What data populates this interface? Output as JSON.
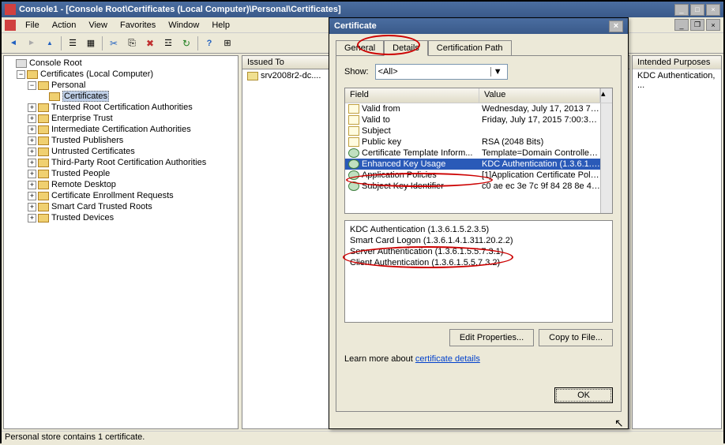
{
  "window": {
    "title": "Console1 - [Console Root\\Certificates (Local Computer)\\Personal\\Certificates]"
  },
  "menu": {
    "file": "File",
    "action": "Action",
    "view": "View",
    "favorites": "Favorites",
    "window": "Window",
    "help": "Help"
  },
  "tree": {
    "root": "Console Root",
    "certs": "Certificates (Local Computer)",
    "personal": "Personal",
    "certificates": "Certificates",
    "trca": "Trusted Root Certification Authorities",
    "et": "Enterprise Trust",
    "ica": "Intermediate Certification Authorities",
    "tpub": "Trusted Publishers",
    "uc": "Untrusted Certificates",
    "tprca": "Third-Party Root Certification Authorities",
    "tp": "Trusted People",
    "rd": "Remote Desktop",
    "cer": "Certificate Enrollment Requests",
    "sctr": "Smart Card Trusted Roots",
    "td": "Trusted Devices"
  },
  "list": {
    "col_issued": "Issued To",
    "col_intended": "Intended Purposes",
    "row0_issued": "srv2008r2-dc....",
    "row0_intended": "KDC Authentication, ..."
  },
  "dialog": {
    "title": "Certificate",
    "tab_general": "General",
    "tab_details": "Details",
    "tab_certpath": "Certification Path",
    "show_label": "Show:",
    "show_value": "<All>",
    "col_field": "Field",
    "col_value": "Value",
    "fields": [
      {
        "icon": "page",
        "name": "Valid from",
        "value": "Wednesday, July 17, 2013 7:..."
      },
      {
        "icon": "page",
        "name": "Valid to",
        "value": "Friday, July 17, 2015 7:00:39 ..."
      },
      {
        "icon": "page",
        "name": "Subject",
        "value": ""
      },
      {
        "icon": "page",
        "name": "Public key",
        "value": "RSA (2048 Bits)"
      },
      {
        "icon": "ext",
        "name": "Certificate Template Inform...",
        "value": "Template=Domain Controller L..."
      },
      {
        "icon": "ext",
        "name": "Enhanced Key Usage",
        "value": "KDC Authentication (1.3.6.1.5...",
        "selected": true
      },
      {
        "icon": "ext",
        "name": "Application Policies",
        "value": "[1]Application Certificate Polic..."
      },
      {
        "icon": "ext",
        "name": "Subject Key Identifier",
        "value": "c0 ae ec 3e 7c 9f 84 28 8e 4f ..."
      }
    ],
    "details": [
      "KDC Authentication (1.3.6.1.5.2.3.5)",
      "Smart Card Logon (1.3.6.1.4.1.311.20.2.2)",
      "Server Authentication (1.3.6.1.5.5.7.3.1)",
      "Client Authentication (1.3.6.1.5.5.7.3.2)"
    ],
    "edit_props": "Edit Properties...",
    "copy_file": "Copy to File...",
    "learn_more_pre": "Learn more about ",
    "learn_more_link": "certificate details",
    "ok": "OK"
  },
  "status": "Personal store contains 1 certificate."
}
